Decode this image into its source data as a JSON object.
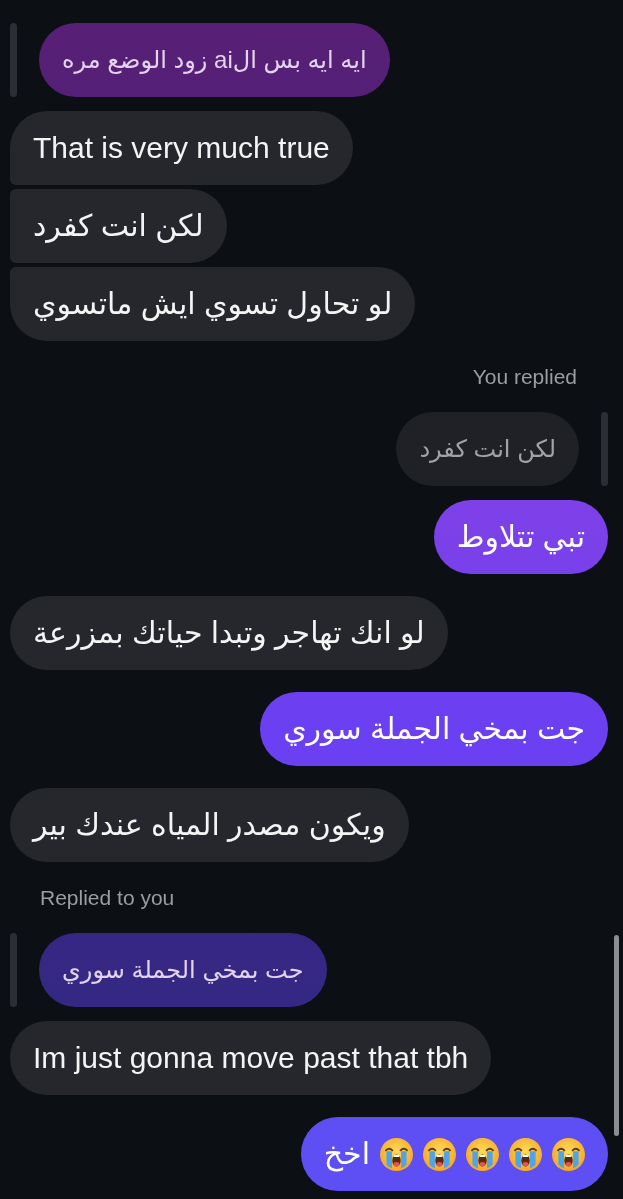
{
  "messages": [
    {
      "kind": "received",
      "quote": {
        "own": true,
        "text": "ايه ايه بس الai زود الوضع مره"
      },
      "text": "That is very much true"
    },
    {
      "kind": "received",
      "text": "لكن انت كفرد"
    },
    {
      "kind": "received",
      "text": "لو تحاول تسوي ايش ماتسوي"
    },
    {
      "kind": "sent",
      "reply_label": "You replied",
      "quote": {
        "own": false,
        "text": "لكن انت كفرد"
      },
      "text": "تبي تتلاوط"
    },
    {
      "kind": "received",
      "text": "لو انك تهاجر وتبدا حياتك بمزرعة"
    },
    {
      "kind": "sent",
      "text": "جت بمخي الجملة سوري"
    },
    {
      "kind": "received",
      "text": "ويكون مصدر المياه عندك بير"
    },
    {
      "kind": "received",
      "reply_label": "Replied to you",
      "quote": {
        "own": true,
        "text": "جت بمخي الجملة سوري"
      },
      "text": "Im just gonna move past that tbh"
    },
    {
      "kind": "sent",
      "parts": [
        {
          "kind": "crying-emoji"
        },
        {
          "kind": "crying-emoji"
        },
        {
          "kind": "crying-emoji"
        },
        {
          "kind": "crying-emoji"
        },
        {
          "kind": "crying-emoji"
        },
        {
          "kind": "text",
          "text": "اخخ"
        }
      ]
    }
  ]
}
